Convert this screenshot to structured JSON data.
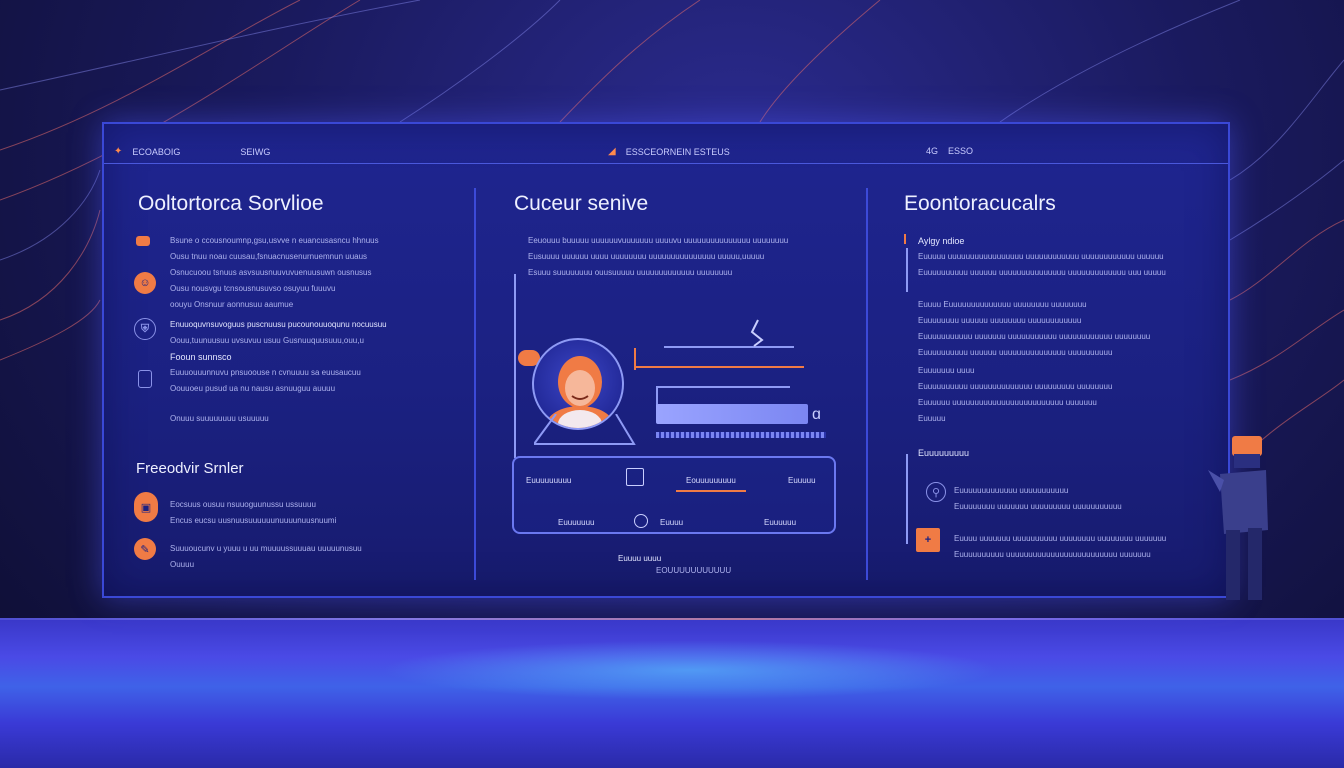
{
  "colors": {
    "accent": "#f07b45",
    "panel": "#1f2590",
    "border": "#3a48d6",
    "text": "#eef0ff"
  },
  "topbar": {
    "left_label_1": "ECOABOIG",
    "left_label_2": "SEIWG",
    "center_label": "ESSCEORNEIN ESTEUS",
    "right_label_1": "4G",
    "right_label_2": "ESSO"
  },
  "left": {
    "title": "Ooltortorca Sorvlioe",
    "items": [
      {
        "icon": "square-bullet-icon",
        "lines": [
          "Bsune o ccousnoumnp,gsu,usvve n euancusasncu hhnuus",
          "Ousu tnuu noau cuusau,fsnuacnusenurnuemnun uuaus",
          "Osnucuoou tsnuus asvsuusnuuvuvuenuusuwn ousnusus"
        ]
      },
      {
        "icon": "chat-icon",
        "lines": [
          "Ousu nousvgu tcnsousnusuvso osuyuu fuuuvu",
          "oouyu Onsnuur aonnusuu aaumue"
        ]
      },
      {
        "icon": "shield-icon",
        "lines": [
          "Enuuoquvnsuvoguus puscnuusu pucounouuoqunu nocuusuu",
          "Oouu,tuunuusuu uvsuvuu usuu Gusnuuquusuuu,ouu,u"
        ]
      },
      {
        "icon": "document-icon",
        "heading": "Fooun sunnsco",
        "lines": [
          "Euuuouuunnuvu pnsuoouse n cvnuuuu sa euusaucuu",
          "Oouuoeu pusud ua nu nausu asnuuguu auuuu",
          "Onuuu suuuuuuuu usuuuuu"
        ]
      }
    ],
    "sub_title": "Freeodvir Srnler",
    "sub_items": [
      {
        "icon": "badge-icon",
        "lines": [
          "Eocsuus ousuu nsuuoguunussu ussuuuu",
          "Encus eucsu uusnuusuuuuuunuuuunuusnuumi"
        ]
      },
      {
        "icon": "pen-icon",
        "lines": [
          "Suuuoucunv u yuuu u uu muuuussuuuau uuuuunusuu",
          "Ouuuu"
        ]
      }
    ]
  },
  "center": {
    "title": "Cuceur senive",
    "lines": [
      "Eeuouuu buuuuu uuuuuuvuuuuuuu uuuuvu uuuuuuuuuuuuuuu uuuuuuuu",
      "Eusuuuu uuuuuu uuuu uuuuuuuu uuuuuuuuuuuuuuu uuuuu,uuuuu",
      "Esuuu suuuuuuuu ouusuuuuu uuuuuuuuuuuuu uuuuuuuu"
    ],
    "card": {
      "label_left": "Euuuuuuuuu",
      "label_mid": "Eouuuuuuuuu",
      "label_right": "Euuuuu",
      "bottom_left": "Euuuuuuu",
      "bottom_mid": "Euuuu",
      "bottom_right": "Euuuuuu"
    },
    "footer_line_1": "Euuuu uuuu",
    "footer_line_2": "EOUUUUUUUUUUU"
  },
  "right": {
    "title": "Eoontoracucalrs",
    "subheading": "Aylgy ndioe",
    "lines": [
      "Euuuuu uuuuuuuuuuuuuuuuu uuuuuuuuuuuu uuuuuuuuuuuu uuuuuu",
      "Euuuuuuuuuu uuuuuu uuuuuuuuuuuuuuu uuuuuuuuuuuuu uuu uuuuu",
      "Euuuu Euuuuuuuuuuuuuu uuuuuuuu uuuuuuuu",
      "Euuuuuuuu uuuuuu uuuuuuuu uuuuuuuuuuuu",
      "Euuuuuuuuuuu uuuuuuu uuuuuuuuuuu uuuuuuuuuuuu uuuuuuuu",
      "Euuuuuuuuuu uuuuuu uuuuuuuuuuuuuuu uuuuuuuuuu",
      "Euuuuuuu uuuu",
      "Euuuuuuuuuu uuuuuuuuuuuuuu uuuuuuuuu uuuuuuuu",
      "Euuuuuu uuuuuuuuuuuuuuuuuuuuuuuuu uuuuuuu",
      "Euuuuu"
    ],
    "section_label": "Euuuuuuuuu",
    "items": [
      {
        "icon": "search-icon",
        "lines": [
          "Euuuuuuuuuuuuu uuuuuuuuuuu",
          "Euuuuuuuu uuuuuuu uuuuuuuuu uuuuuuuuuuu"
        ]
      },
      {
        "icon": "tag-icon",
        "lines": [
          "Euuuu uuuuuuu uuuuuuuuuu uuuuuuuu uuuuuuuu uuuuuuu",
          "Euuuuuuuuuu uuuuuuuuuuuuuuuuuuuuuuuuu uuuuuuu"
        ]
      }
    ]
  }
}
